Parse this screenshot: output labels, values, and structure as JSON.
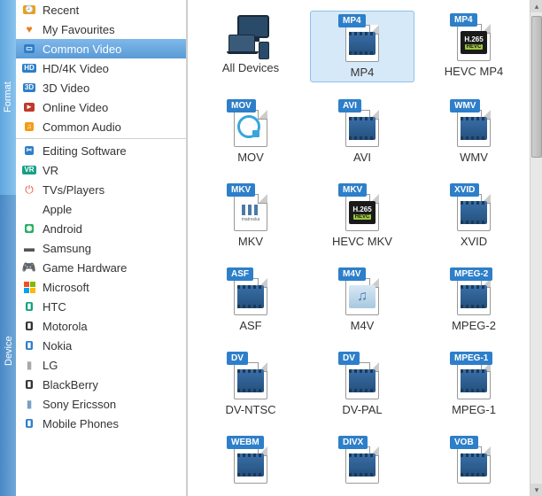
{
  "tabs": {
    "format": "Format",
    "device": "Device"
  },
  "sidebar": {
    "format_items": [
      {
        "label": "Recent",
        "icon": "clock-icon",
        "color": "bg-orange",
        "glyph": "🕘"
      },
      {
        "label": "My Favourites",
        "icon": "heart-icon",
        "color": "",
        "glyph": "♥"
      },
      {
        "label": "Common Video",
        "icon": "film-icon",
        "color": "bg-blue",
        "glyph": "▭",
        "selected": true
      },
      {
        "label": "HD/4K Video",
        "icon": "hd-icon",
        "color": "bg-blue",
        "glyph": "HD"
      },
      {
        "label": "3D Video",
        "icon": "3d-icon",
        "color": "bg-blue",
        "glyph": "3D"
      },
      {
        "label": "Online Video",
        "icon": "online-icon",
        "color": "bg-red",
        "glyph": "►"
      },
      {
        "label": "Common Audio",
        "icon": "audio-icon",
        "color": "bg-orange",
        "glyph": "♫"
      }
    ],
    "device_items": [
      {
        "label": "Editing Software",
        "icon": "scissors-icon",
        "color": "bg-blue",
        "glyph": "✂"
      },
      {
        "label": "VR",
        "icon": "vr-icon",
        "color": "bg-teal",
        "glyph": "VR"
      },
      {
        "label": "TVs/Players",
        "icon": "tv-icon",
        "color": "",
        "glyph": "⏻"
      },
      {
        "label": "Apple",
        "icon": "apple-icon",
        "color": "",
        "glyph": ""
      },
      {
        "label": "Android",
        "icon": "android-icon",
        "color": "bg-green",
        "glyph": "◉"
      },
      {
        "label": "Samsung",
        "icon": "samsung-icon",
        "color": "",
        "glyph": "▬"
      },
      {
        "label": "Game Hardware",
        "icon": "game-icon",
        "color": "",
        "glyph": "🎮"
      },
      {
        "label": "Microsoft",
        "icon": "microsoft-icon",
        "color": "",
        "glyph": "⊞"
      },
      {
        "label": "HTC",
        "icon": "htc-icon",
        "color": "bg-teal",
        "glyph": "▮"
      },
      {
        "label": "Motorola",
        "icon": "motorola-icon",
        "color": "bg-dark",
        "glyph": "▮"
      },
      {
        "label": "Nokia",
        "icon": "nokia-icon",
        "color": "bg-blue",
        "glyph": "▮"
      },
      {
        "label": "LG",
        "icon": "lg-icon",
        "color": "",
        "glyph": "▮"
      },
      {
        "label": "BlackBerry",
        "icon": "blackberry-icon",
        "color": "bg-dark",
        "glyph": "▮"
      },
      {
        "label": "Sony Ericsson",
        "icon": "sony-icon",
        "color": "",
        "glyph": "▮"
      },
      {
        "label": "Mobile Phones",
        "icon": "mobile-icon",
        "color": "bg-blue",
        "glyph": "▮"
      }
    ]
  },
  "formats": [
    {
      "label": "All Devices",
      "tag": "",
      "type": "all-devices"
    },
    {
      "label": "MP4",
      "tag": "MP4",
      "type": "film",
      "selected": true
    },
    {
      "label": "HEVC MP4",
      "tag": "MP4",
      "type": "hevc"
    },
    {
      "label": "MOV",
      "tag": "MOV",
      "type": "qt"
    },
    {
      "label": "AVI",
      "tag": "AVI",
      "type": "film"
    },
    {
      "label": "WMV",
      "tag": "WMV",
      "type": "film"
    },
    {
      "label": "MKV",
      "tag": "MKV",
      "type": "mkv"
    },
    {
      "label": "HEVC MKV",
      "tag": "MKV",
      "type": "hevc"
    },
    {
      "label": "XVID",
      "tag": "XVID",
      "type": "film"
    },
    {
      "label": "ASF",
      "tag": "ASF",
      "type": "film"
    },
    {
      "label": "M4V",
      "tag": "M4V",
      "type": "itunes"
    },
    {
      "label": "MPEG-2",
      "tag": "MPEG-2",
      "type": "film"
    },
    {
      "label": "DV-NTSC",
      "tag": "DV",
      "type": "film"
    },
    {
      "label": "DV-PAL",
      "tag": "DV",
      "type": "film"
    },
    {
      "label": "MPEG-1",
      "tag": "MPEG-1",
      "type": "film"
    },
    {
      "label": "",
      "tag": "WEBM",
      "type": "film"
    },
    {
      "label": "",
      "tag": "DIVX",
      "type": "film"
    },
    {
      "label": "",
      "tag": "VOB",
      "type": "film"
    }
  ]
}
